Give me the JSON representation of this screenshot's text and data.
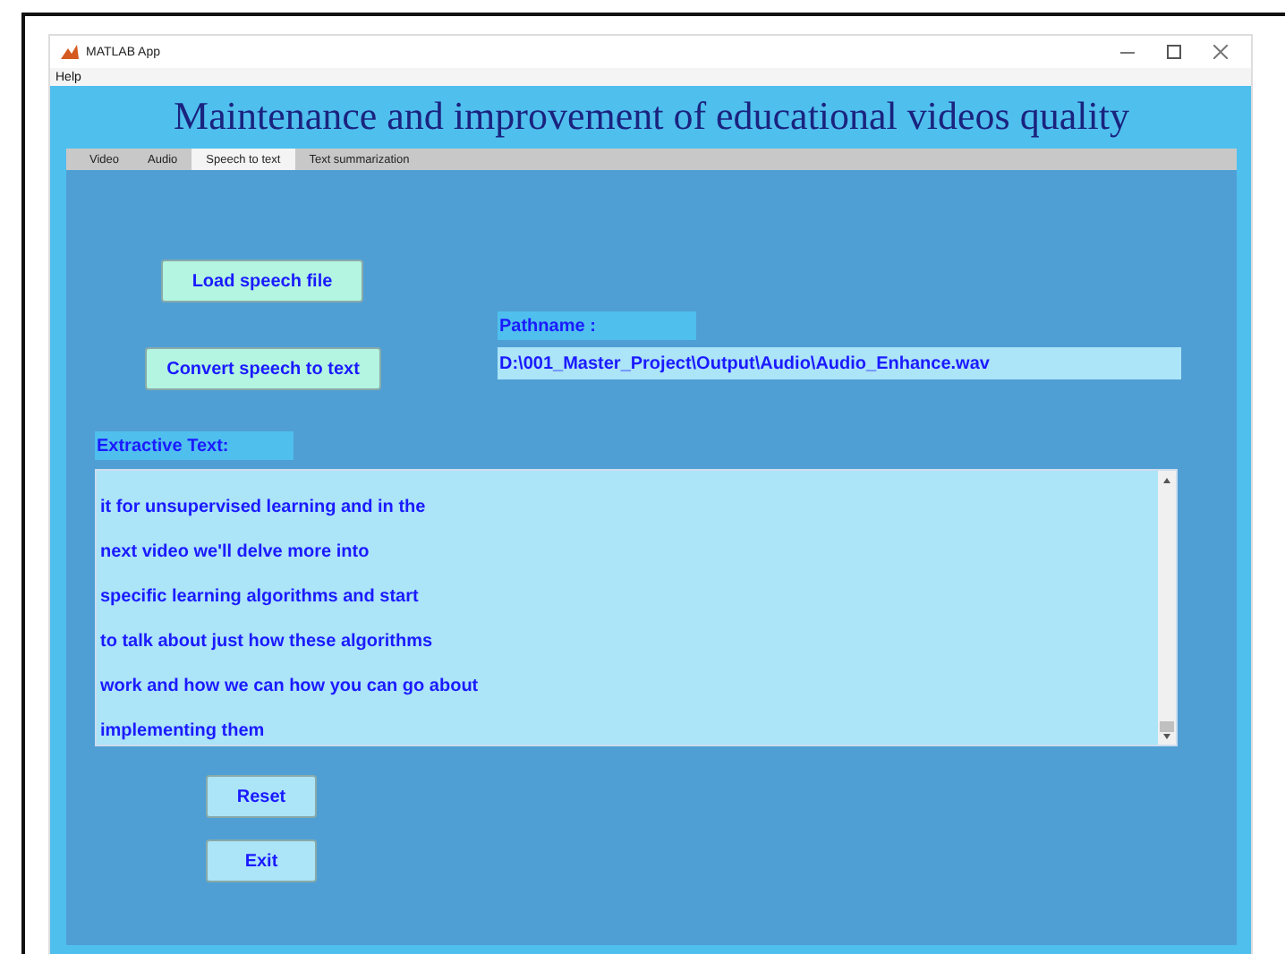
{
  "window": {
    "title": "MATLAB App"
  },
  "menu": [
    "Help"
  ],
  "app_title": "Maintenance and improvement of educational videos quality",
  "tabs": [
    {
      "label": "Video",
      "selected": false
    },
    {
      "label": "Audio",
      "selected": false
    },
    {
      "label": "Speech to text",
      "selected": true
    },
    {
      "label": "Text summarization",
      "selected": false
    }
  ],
  "load_button": "Load speech file",
  "pathname_label": "Pathname :",
  "convert_button": "Convert speech to text",
  "pathname_value": "D:\\001_Master_Project\\Output\\Audio\\Audio_Enhance.wav",
  "extractive_label": "Extractive Text:",
  "extractive_lines": [
    "it for unsupervised learning and in the",
    "next video we'll delve more into",
    "specific learning algorithms and start",
    "to talk about just how these algorithms",
    "work and how we can how you can go about",
    "implementing them"
  ],
  "buttons": [
    "Reset",
    "Exit"
  ]
}
